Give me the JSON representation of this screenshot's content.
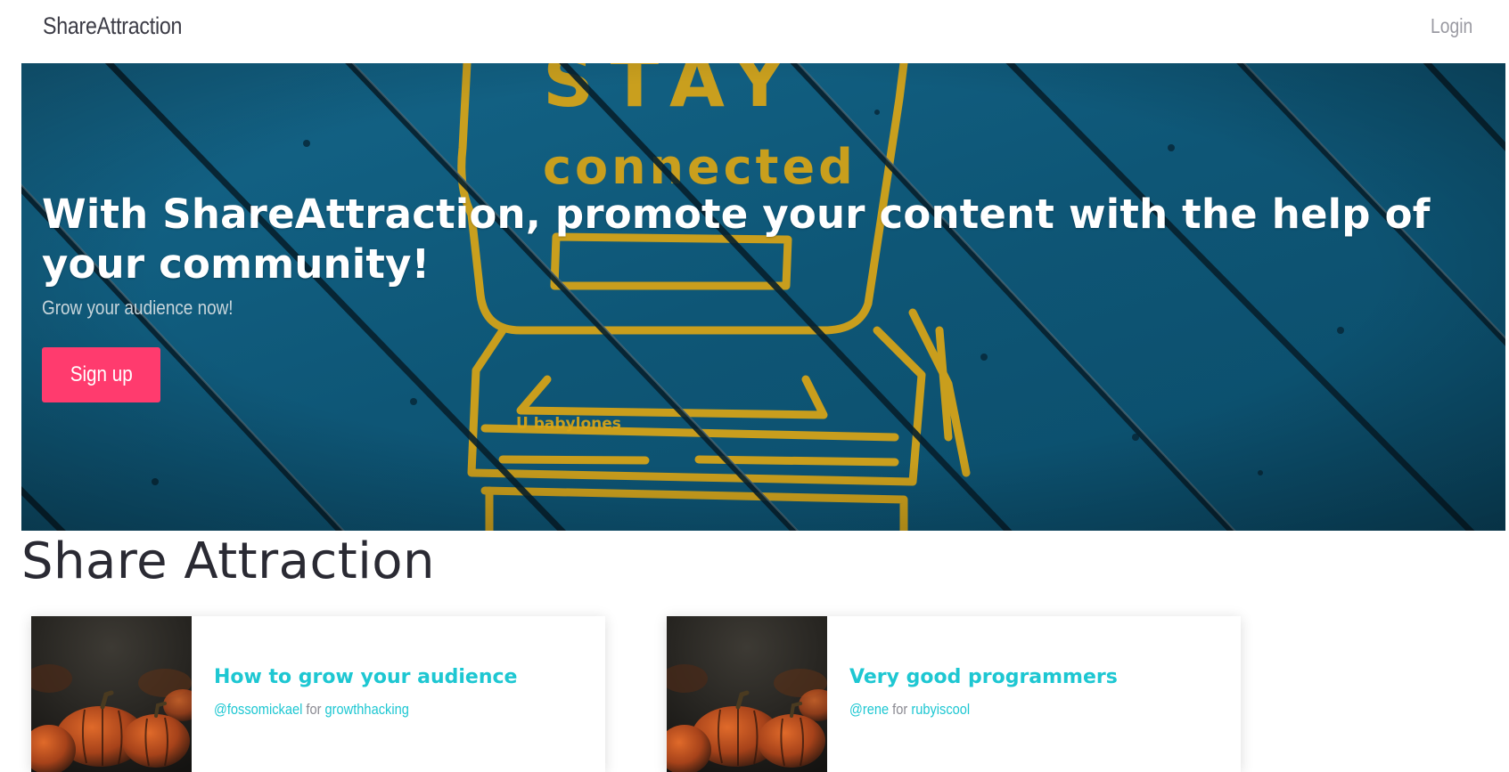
{
  "navbar": {
    "brand": "ShareAttraction",
    "login_label": "Login"
  },
  "hero": {
    "title": "With ShareAttraction, promote your content with the help of your community!",
    "subtitle": "Grow your audience now!",
    "signup_label": "Sign up",
    "background_text": "STAY connected",
    "colors": {
      "background": "#0f5878",
      "accent_button": "#ff3b6e",
      "graffiti": "#d9a516"
    }
  },
  "section": {
    "title": "Share Attraction"
  },
  "cards": [
    {
      "title": "How to grow your audience",
      "author": "@fossomickael",
      "for_text": "for",
      "tag": "growthhacking",
      "thumbnail": "pumpkins-image"
    },
    {
      "title": "Very good programmers",
      "author": "@rene",
      "for_text": "for",
      "tag": "rubyiscool",
      "thumbnail": "pumpkins-image"
    }
  ],
  "colors": {
    "link": "#1ec7d2",
    "muted": "#8a8a92"
  }
}
